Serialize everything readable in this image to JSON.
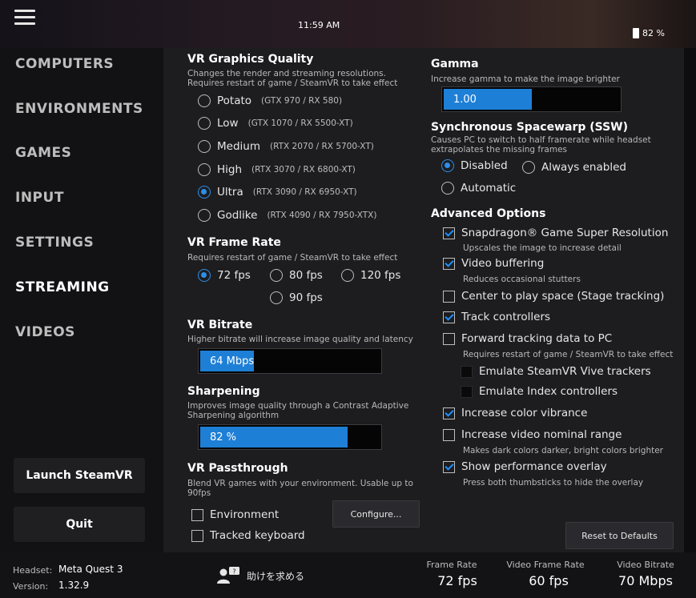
{
  "status_bar": {
    "time": "11:59 AM",
    "battery": "82 %"
  },
  "nav": {
    "items": [
      "COMPUTERS",
      "ENVIRONMENTS",
      "GAMES",
      "INPUT",
      "SETTINGS",
      "STREAMING",
      "VIDEOS"
    ],
    "active": "STREAMING",
    "launch_label": "Launch SteamVR",
    "quit_label": "Quit"
  },
  "graphics": {
    "title": "VR Graphics Quality",
    "desc": "Changes the render and streaming resolutions. Requires restart of game / SteamVR to take effect",
    "options": [
      {
        "label": "Potato",
        "hint": "(GTX 970 / RX 580)",
        "selected": false
      },
      {
        "label": "Low",
        "hint": "(GTX 1070 / RX 5500-XT)",
        "selected": false
      },
      {
        "label": "Medium",
        "hint": "(RTX 2070 / RX 5700-XT)",
        "selected": false
      },
      {
        "label": "High",
        "hint": "(RTX 3070 / RX 6800-XT)",
        "selected": false
      },
      {
        "label": "Ultra",
        "hint": "(RTX 3090 / RX 6950-XT)",
        "selected": true
      },
      {
        "label": "Godlike",
        "hint": "(RTX 4090 / RX 7950-XTX)",
        "selected": false
      }
    ]
  },
  "frame_rate": {
    "title": "VR Frame Rate",
    "desc": "Requires restart of game / SteamVR to take effect",
    "options": [
      {
        "label": "72 fps",
        "selected": true
      },
      {
        "label": "80 fps",
        "selected": false
      },
      {
        "label": "120 fps",
        "selected": false
      },
      {
        "label": "90 fps",
        "selected": false
      }
    ]
  },
  "bitrate": {
    "title": "VR Bitrate",
    "desc": "Higher bitrate will increase image quality and latency",
    "value": "64 Mbps",
    "fraction": 0.3
  },
  "sharpening": {
    "title": "Sharpening",
    "desc": "Improves image quality through a Contrast Adaptive Sharpening algorithm",
    "value": "82 %",
    "fraction": 0.82
  },
  "passthrough": {
    "title": "VR Passthrough",
    "desc": "Blend VR games with your environment. Usable up to 90fps",
    "configure_label": "Configure...",
    "options": [
      {
        "label": "Environment",
        "checked": false
      },
      {
        "label": "Tracked keyboard",
        "checked": false
      }
    ]
  },
  "gamma": {
    "title": "Gamma",
    "desc": "Increase gamma to make the image brighter",
    "value": "1.00",
    "fraction": 0.5
  },
  "ssw": {
    "title": "Synchronous Spacewarp (SSW)",
    "desc": "Causes PC to switch to half framerate while headset extrapolates the missing frames",
    "options": [
      {
        "label": "Disabled",
        "selected": true
      },
      {
        "label": "Always enabled",
        "selected": false
      },
      {
        "label": "Automatic",
        "selected": false
      }
    ]
  },
  "advanced": {
    "title": "Advanced Options",
    "options": [
      {
        "label": "Snapdragon® Game Super Resolution",
        "desc": "Upscales the image to increase detail",
        "checked": true
      },
      {
        "label": "Video buffering",
        "desc": "Reduces occasional stutters",
        "checked": true
      },
      {
        "label": "Center to play space (Stage tracking)",
        "desc": "",
        "checked": false
      },
      {
        "label": "Track controllers",
        "desc": "",
        "checked": true
      },
      {
        "label": "Forward tracking data to PC",
        "desc": "Requires restart of game / SteamVR to take effect",
        "checked": false
      },
      {
        "label": "Emulate SteamVR Vive trackers",
        "desc": "",
        "checked": false
      },
      {
        "label": "Emulate Index controllers",
        "desc": "",
        "checked": false
      },
      {
        "label": "Increase color vibrance",
        "desc": "",
        "checked": true
      },
      {
        "label": "Increase video nominal range",
        "desc": "Makes dark colors darker, bright colors brighter",
        "checked": false
      },
      {
        "label": "Show performance overlay",
        "desc": "Press both thumbsticks to hide the overlay",
        "checked": true
      }
    ],
    "reset_label": "Reset to Defaults"
  },
  "footer": {
    "headset_label": "Headset:",
    "headset_value": "Meta Quest 3",
    "version_label": "Version:",
    "version_value": "1.32.9",
    "help_label": "助けを求める",
    "stats": [
      {
        "label": "Frame Rate",
        "value": "72 fps"
      },
      {
        "label": "Video Frame Rate",
        "value": "60 fps"
      },
      {
        "label": "Video Bitrate",
        "value": "70 Mbps"
      }
    ]
  }
}
